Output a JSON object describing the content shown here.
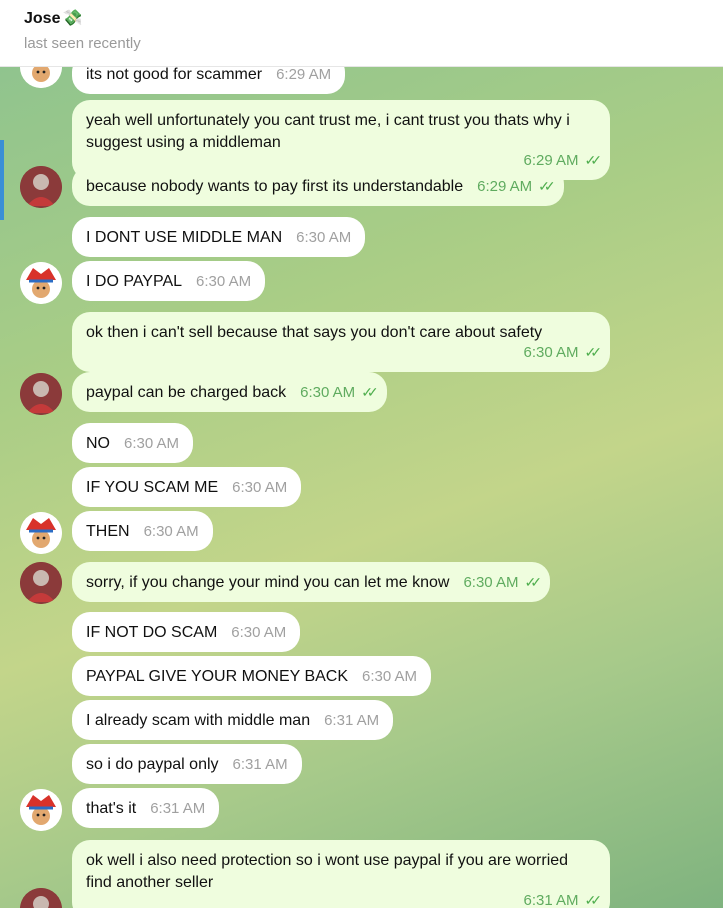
{
  "header": {
    "contact_name": "Jose",
    "contact_emoji": "💸",
    "status": "last seen recently"
  },
  "messages": [
    {
      "from": "them",
      "text": "its not good for scammer",
      "time": "6:29 AM"
    },
    {
      "from": "me",
      "text": "yeah well unfortunately you cant trust me, i cant trust you thats why i suggest using a middleman",
      "time": "6:29 AM"
    },
    {
      "from": "me",
      "text": "because nobody wants to pay first its understandable",
      "time": "6:29 AM"
    },
    {
      "from": "them",
      "text": "I DONT USE MIDDLE MAN",
      "time": "6:30 AM"
    },
    {
      "from": "them",
      "text": "I DO PAYPAL",
      "time": "6:30 AM"
    },
    {
      "from": "me",
      "text": "ok then i can't sell because that says you don't care about safety",
      "time": "6:30 AM"
    },
    {
      "from": "me",
      "text": "paypal can be charged back",
      "time": "6:30 AM"
    },
    {
      "from": "them",
      "text": "NO",
      "time": "6:30 AM"
    },
    {
      "from": "them",
      "text": "IF YOU SCAM ME",
      "time": "6:30 AM"
    },
    {
      "from": "them",
      "text": "THEN",
      "time": "6:30 AM"
    },
    {
      "from": "me",
      "text": "sorry, if you change your mind you can let me know",
      "time": "6:30 AM"
    },
    {
      "from": "them",
      "text": "IF NOT DO SCAM",
      "time": "6:30 AM"
    },
    {
      "from": "them",
      "text": "PAYPAL GIVE YOUR MONEY BACK",
      "time": "6:30 AM"
    },
    {
      "from": "them",
      "text": "I already scam with middle man",
      "time": "6:31 AM"
    },
    {
      "from": "them",
      "text": "so i do paypal only",
      "time": "6:31 AM"
    },
    {
      "from": "them",
      "text": "that's it",
      "time": "6:31 AM"
    },
    {
      "from": "me",
      "text": "ok well i also need protection so i wont use paypal if you are worried find another seller",
      "time": "6:31 AM"
    }
  ],
  "read_receipt_icon": "double-check-icon",
  "colors": {
    "incoming_bubble": "#ffffff",
    "outgoing_bubble": "#effdde",
    "read_check": "#4fae4e",
    "chat_bg": "#a9cd86"
  }
}
